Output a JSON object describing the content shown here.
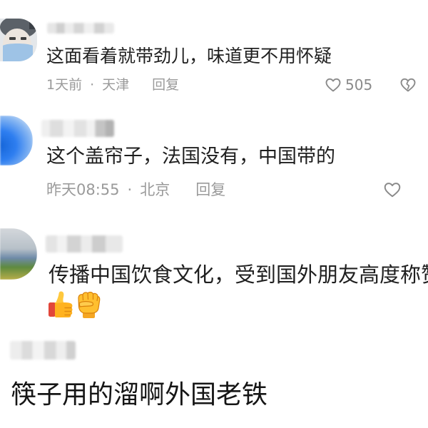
{
  "colors": {
    "background": "#ffffff",
    "text": "#1f1f1f",
    "meta": "#9a9a9a",
    "icon": "#8a8a8a"
  },
  "comments": [
    {
      "text": "这面看着就带劲儿，味道更不用怀疑",
      "time": "1天前",
      "separator": "·",
      "location": "天津",
      "reply_label": "回复",
      "like_count": "505",
      "like_icon": "heart-outline-icon",
      "dislike_icon": "broken-heart-icon"
    },
    {
      "text": "这个盖帘子，法国没有，中国带的",
      "time": "昨天08:55",
      "separator": "·",
      "location": "北京",
      "reply_label": "回复",
      "like_icon": "heart-outline-icon"
    },
    {
      "text": "传播中国饮食文化，受到国外朋友高度称赞",
      "emoji": [
        "thumbs-up-emoji",
        "raised-fist-emoji"
      ]
    },
    {
      "text": "筷子用的溜啊外国老铁"
    }
  ]
}
